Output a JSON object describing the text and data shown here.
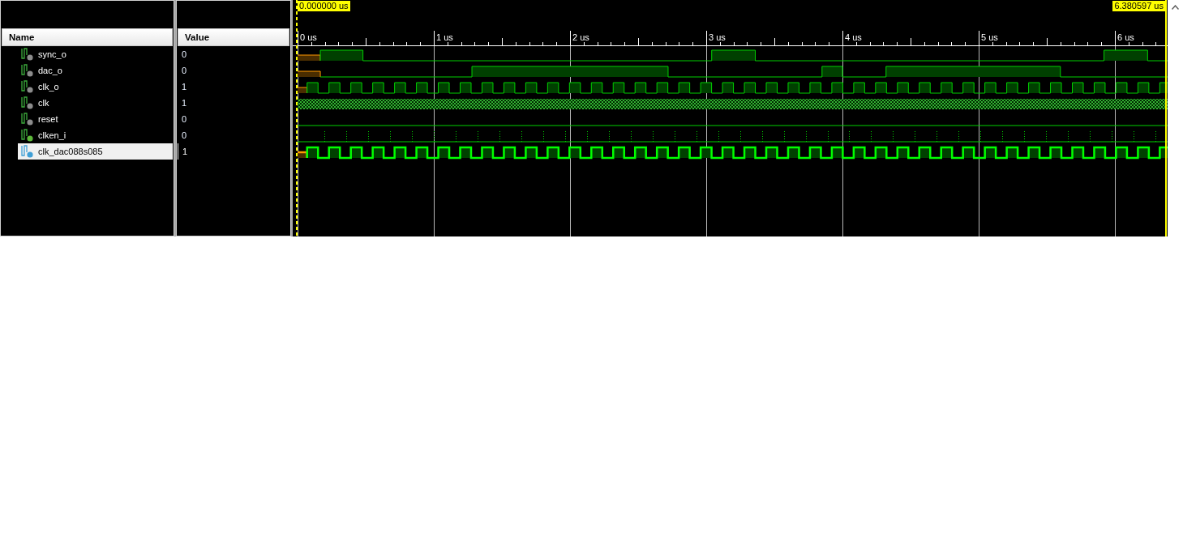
{
  "name_header": "Name",
  "value_header": "Value",
  "cursors": {
    "start": "0.000000 us",
    "end": "6.380597 us"
  },
  "time_ticks": [
    "0 us",
    "1 us",
    "2 us",
    "3 us",
    "4 us",
    "5 us",
    "6 us"
  ],
  "signals": [
    {
      "name": "sync_o",
      "value": "0",
      "kind": "data",
      "color": "#8c8c8c",
      "selected": false
    },
    {
      "name": "dac_o",
      "value": "0",
      "kind": "data",
      "color": "#8c8c8c",
      "selected": false
    },
    {
      "name": "clk_o",
      "value": "1",
      "kind": "clock",
      "color": "#8c8c8c",
      "selected": false
    },
    {
      "name": "clk",
      "value": "1",
      "kind": "dense",
      "color": "#8c8c8c",
      "selected": false
    },
    {
      "name": "reset",
      "value": "0",
      "kind": "flat",
      "color": "#8c8c8c",
      "selected": false
    },
    {
      "name": "clken_i",
      "value": "0",
      "kind": "strobe",
      "color": "#5cb83a",
      "selected": false
    },
    {
      "name": "clk_dac088s085",
      "value": "1",
      "kind": "clock",
      "color": "#3f9fd6",
      "selected": true
    }
  ]
}
